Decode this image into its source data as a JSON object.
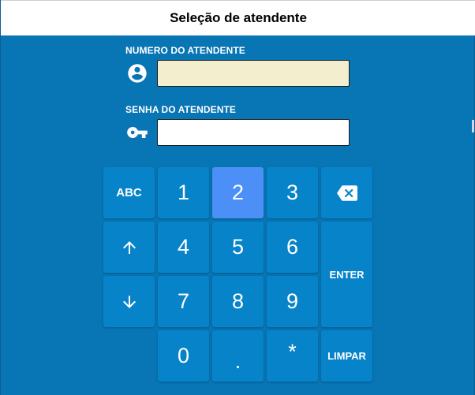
{
  "window": {
    "title": "Seleção de atendente"
  },
  "form": {
    "attendant_number": {
      "label": "NUMERO DO ATENDENTE",
      "value": "",
      "icon": "account-circle-icon",
      "bg_color": "#f3eecd"
    },
    "attendant_password": {
      "label": "SENHA DO ATENDENTE",
      "value": "",
      "icon": "key-icon",
      "bg_color": "#ffffff"
    }
  },
  "keypad": {
    "abc": "ABC",
    "digits": {
      "d1": "1",
      "d2": "2",
      "d3": "3",
      "d4": "4",
      "d5": "5",
      "d6": "6",
      "d7": "7",
      "d8": "8",
      "d9": "9",
      "d0": "0"
    },
    "dot": ".",
    "star": "*",
    "enter": "ENTER",
    "clear": "LIMPAR",
    "backspace_icon": "backspace-icon",
    "up_icon": "arrow-up-icon",
    "down_icon": "arrow-down-icon",
    "active_key": "2"
  },
  "colors": {
    "background": "#0875b5",
    "key": "#0683c9",
    "key_active": "#4b8ff7"
  }
}
